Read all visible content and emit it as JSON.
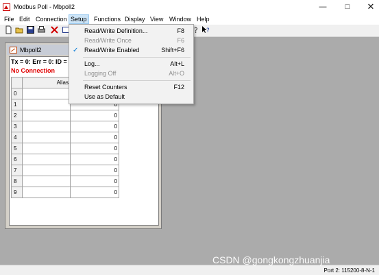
{
  "window": {
    "title": "Modbus Poll - Mbpoll2"
  },
  "menu": [
    {
      "label": "File"
    },
    {
      "label": "Edit"
    },
    {
      "label": "Connection"
    },
    {
      "label": "Setup"
    },
    {
      "label": "Functions"
    },
    {
      "label": "Display"
    },
    {
      "label": "View"
    },
    {
      "label": "Window"
    },
    {
      "label": "Help"
    }
  ],
  "setup_menu": {
    "items": [
      {
        "label": "Read/Write Definition...",
        "shortcut": "F8",
        "enabled": true,
        "checked": false
      },
      {
        "label": "Read/Write Once",
        "shortcut": "F6",
        "enabled": false,
        "checked": false
      },
      {
        "label": "Read/Write Enabled",
        "shortcut": "Shift+F6",
        "enabled": true,
        "checked": true
      },
      {
        "label": "Log...",
        "shortcut": "Alt+L",
        "enabled": true,
        "checked": false
      },
      {
        "label": "Logging Off",
        "shortcut": "Alt+O",
        "enabled": false,
        "checked": false
      },
      {
        "label": "Reset Counters",
        "shortcut": "F12",
        "enabled": true,
        "checked": false
      },
      {
        "label": "Use as Default",
        "shortcut": "",
        "enabled": true,
        "checked": false
      }
    ]
  },
  "child_window": {
    "title": "Mbpoll2",
    "status_line": "Tx = 0: Err = 0: ID =",
    "connection_status": "No Connection",
    "table": {
      "column_header": "Alias",
      "rows": [
        {
          "index": "0",
          "value": ""
        },
        {
          "index": "1",
          "value": "0"
        },
        {
          "index": "2",
          "value": "0"
        },
        {
          "index": "3",
          "value": "0"
        },
        {
          "index": "4",
          "value": "0"
        },
        {
          "index": "5",
          "value": "0"
        },
        {
          "index": "6",
          "value": "0"
        },
        {
          "index": "7",
          "value": "0"
        },
        {
          "index": "8",
          "value": "0"
        },
        {
          "index": "9",
          "value": "0"
        }
      ]
    }
  },
  "statusbar": {
    "port": "Port 2: 115200-8-N-1"
  },
  "watermark": "CSDN @gongkongzhuanjia",
  "colors": {
    "selection": "#0078d7",
    "error_text": "#e00000",
    "mdi_background": "#ababab"
  }
}
